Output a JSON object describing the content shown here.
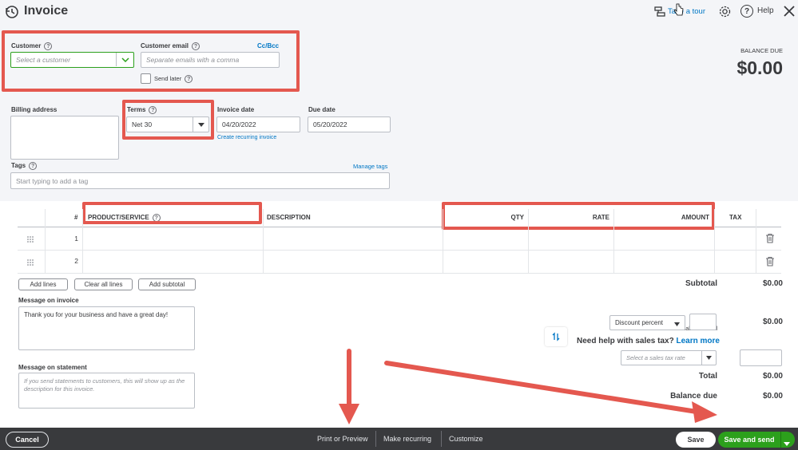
{
  "header": {
    "title": "Invoice",
    "take_tour": "Take a tour",
    "help": "Help"
  },
  "balance": {
    "label": "BALANCE DUE",
    "amount": "$0.00"
  },
  "customer": {
    "label": "Customer",
    "placeholder": "Select a customer"
  },
  "customer_email": {
    "label": "Customer email",
    "placeholder": "Separate emails with a comma",
    "cc_bcc": "Cc/Bcc",
    "send_later": "Send later"
  },
  "billing": {
    "label": "Billing address"
  },
  "terms": {
    "label": "Terms",
    "value": "Net 30"
  },
  "invoice_date": {
    "label": "Invoice date",
    "value": "04/20/2022",
    "recurring_link": "Create recurring invoice"
  },
  "due_date": {
    "label": "Due date",
    "value": "05/20/2022"
  },
  "tags": {
    "label": "Tags",
    "manage": "Manage tags",
    "placeholder": "Start typing to add a tag"
  },
  "table": {
    "headers": {
      "num": "#",
      "product": "PRODUCT/SERVICE",
      "description": "DESCRIPTION",
      "qty": "QTY",
      "rate": "RATE",
      "amount": "AMOUNT",
      "tax": "TAX"
    },
    "rows": [
      {
        "num": "1"
      },
      {
        "num": "2"
      }
    ]
  },
  "line_buttons": {
    "add_lines": "Add lines",
    "clear_all": "Clear all lines",
    "add_subtotal": "Add subtotal"
  },
  "message_invoice": {
    "label": "Message on invoice",
    "value": "Thank you for your business and have a great day!"
  },
  "message_statement": {
    "label": "Message on statement",
    "placeholder": "If you send statements to customers, this will show up as the description for this invoice."
  },
  "totals": {
    "subtotal_label": "Subtotal",
    "subtotal_value": "$0.00",
    "discount_select": "Discount percent",
    "discount_value": "$0.00",
    "taxable_subtotal": "Taxable subtotal",
    "sales_tax_help": "Need help with sales tax?",
    "learn_more": "Learn more",
    "tax_rate_placeholder": "Select a sales tax rate",
    "total_label": "Total",
    "total_value": "$0.00",
    "balance_due_label": "Balance due",
    "balance_due_value": "$0.00"
  },
  "footer": {
    "cancel": "Cancel",
    "print_preview": "Print or Preview",
    "make_recurring": "Make recurring",
    "customize": "Customize",
    "save": "Save",
    "save_and_send": "Save and send"
  },
  "colors": {
    "annotation_red": "#e4584f",
    "primary_green": "#2ca01c",
    "link_blue": "#0077c5",
    "footer_dark": "#393a3d"
  }
}
